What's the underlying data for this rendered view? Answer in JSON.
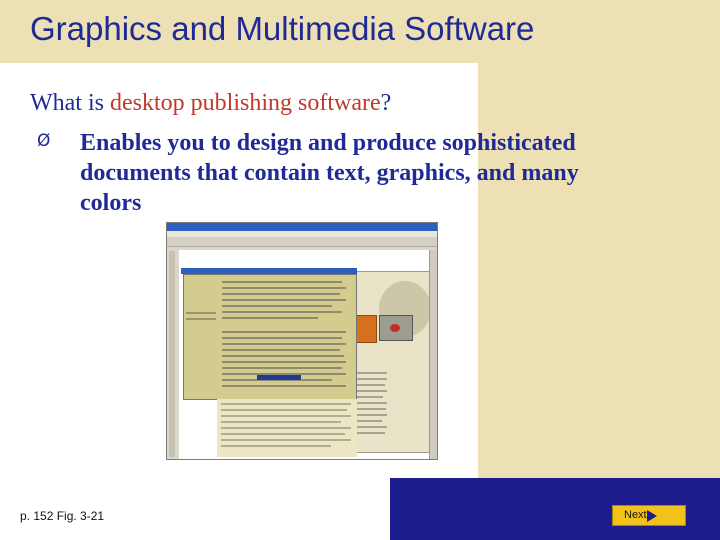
{
  "slide": {
    "title": "Graphics and Multimedia Software",
    "question_prefix": "What is ",
    "question_term": "desktop publishing software",
    "question_suffix": "?",
    "bullet_marker": "Ø",
    "bullet_text": "Enables you to design and produce sophisticated documents that contain text, graphics, and many colors",
    "caption": "p. 152 Fig. 3-21",
    "next_label": "Next"
  },
  "colors": {
    "title_band": "#ede0b4",
    "title_text": "#1f2a96",
    "accent_text": "#c0392b",
    "bottom_bar": "#1c1c8c",
    "next_button": "#f2c21b"
  },
  "icons": {
    "bullet": "arrow-bullet-icon",
    "next": "next-arrow-icon"
  }
}
